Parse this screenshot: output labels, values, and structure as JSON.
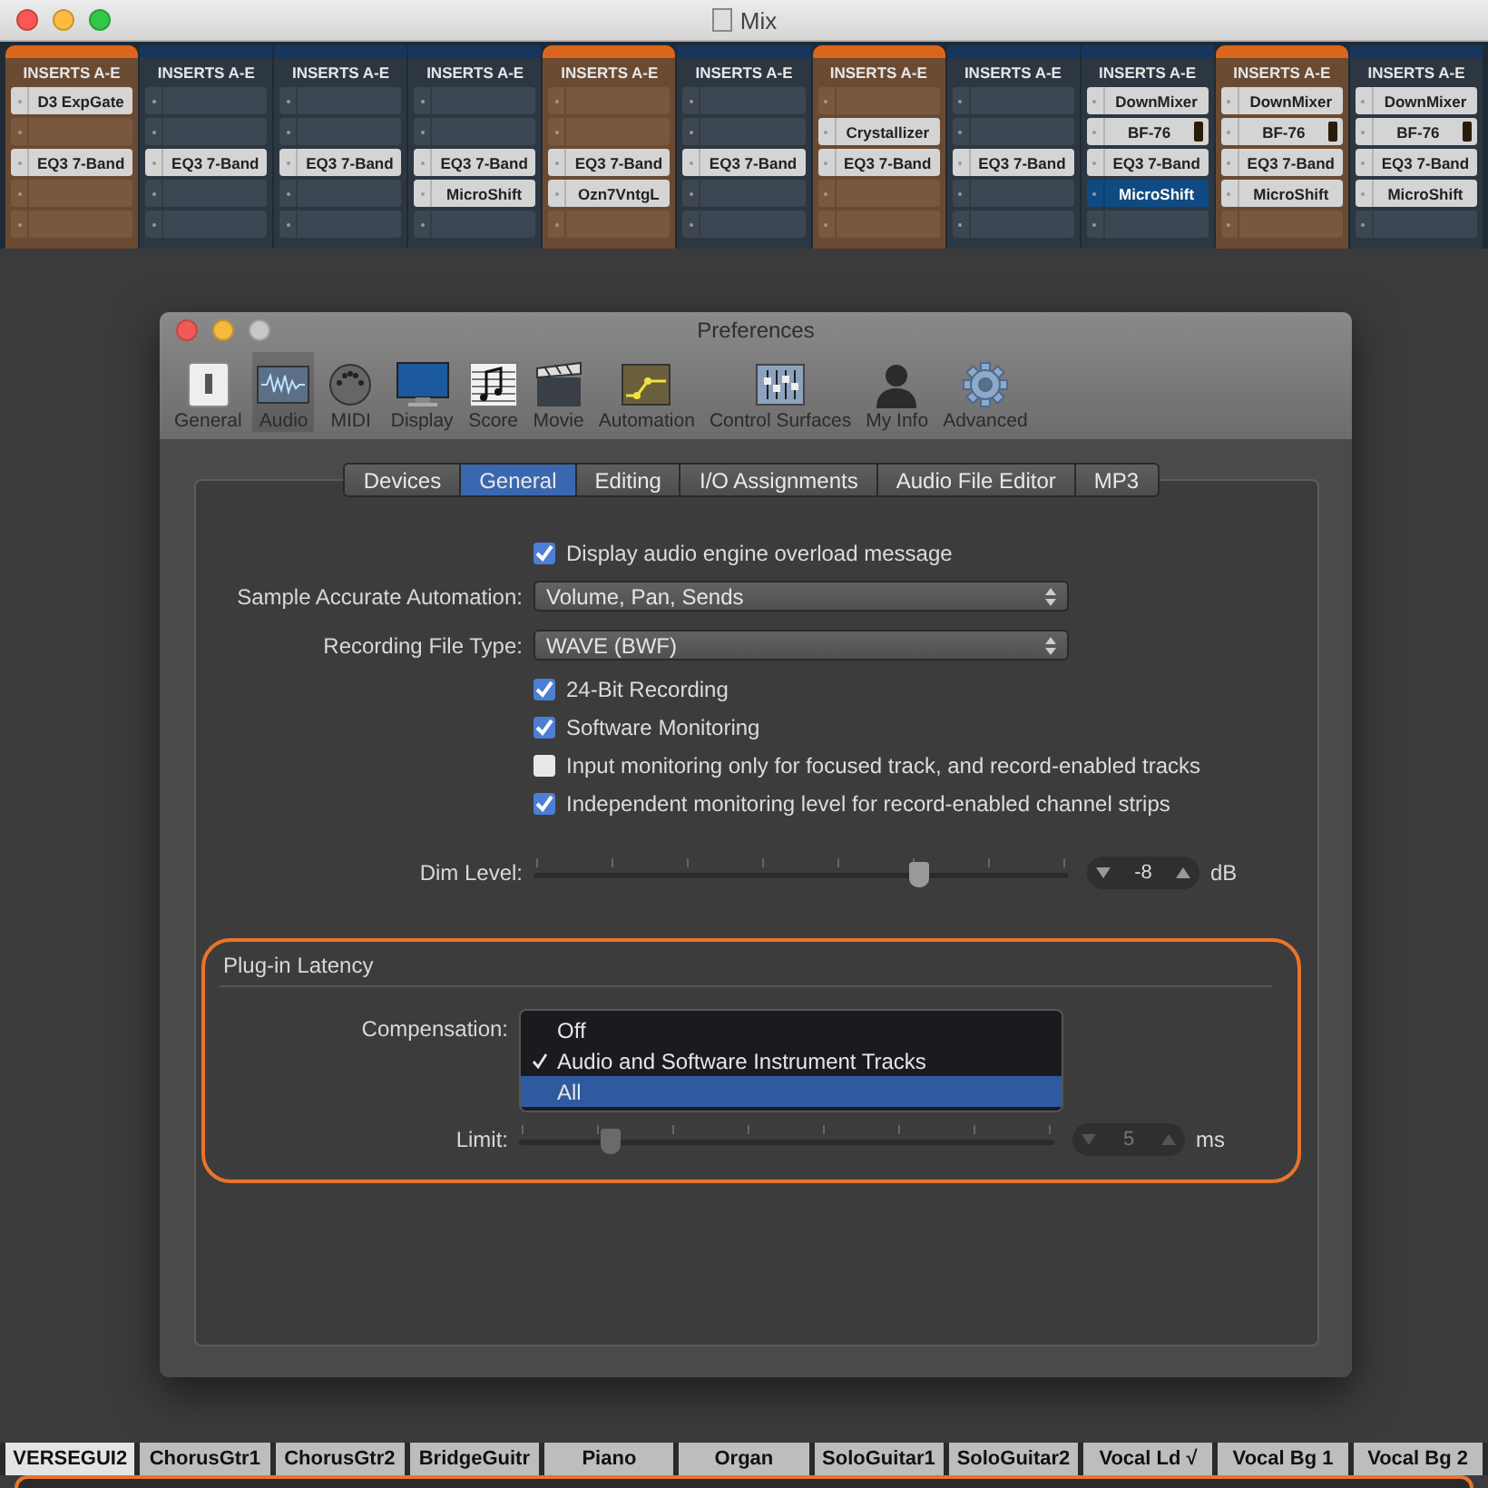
{
  "app_window": {
    "title": "Mix"
  },
  "strips": [
    {
      "header": "INSERTS A-E",
      "selected": true,
      "slots": [
        {
          "kind": "plugin",
          "name": "D3 ExpGate",
          "selected": false
        },
        {
          "kind": "empty",
          "selected": false
        },
        {
          "kind": "plugin",
          "name": "EQ3 7-Band",
          "selected": false
        },
        {
          "kind": "empty",
          "selected": false
        },
        {
          "kind": "empty",
          "selected": false
        }
      ]
    },
    {
      "header": "INSERTS A-E",
      "selected": false,
      "slots": [
        {
          "kind": "empty",
          "selected": false
        },
        {
          "kind": "empty",
          "selected": false
        },
        {
          "kind": "plugin",
          "name": "EQ3 7-Band",
          "selected": false
        },
        {
          "kind": "empty",
          "selected": false
        },
        {
          "kind": "empty",
          "selected": false
        }
      ]
    },
    {
      "header": "INSERTS A-E",
      "selected": false,
      "slots": [
        {
          "kind": "empty",
          "selected": false
        },
        {
          "kind": "empty",
          "selected": false
        },
        {
          "kind": "plugin",
          "name": "EQ3 7-Band",
          "selected": false
        },
        {
          "kind": "empty",
          "selected": false
        },
        {
          "kind": "empty",
          "selected": false
        }
      ]
    },
    {
      "header": "INSERTS A-E",
      "selected": false,
      "slots": [
        {
          "kind": "empty",
          "selected": false
        },
        {
          "kind": "empty",
          "selected": false
        },
        {
          "kind": "plugin",
          "name": "EQ3 7-Band",
          "selected": false
        },
        {
          "kind": "plugin",
          "name": "MicroShift",
          "selected": false
        },
        {
          "kind": "empty",
          "selected": false
        }
      ]
    },
    {
      "header": "INSERTS A-E",
      "selected": true,
      "slots": [
        {
          "kind": "empty",
          "selected": false
        },
        {
          "kind": "empty",
          "selected": false
        },
        {
          "kind": "plugin",
          "name": "EQ3 7-Band",
          "selected": false
        },
        {
          "kind": "plugin",
          "name": "Ozn7VntgL",
          "selected": false
        },
        {
          "kind": "empty",
          "selected": false
        }
      ]
    },
    {
      "header": "INSERTS A-E",
      "selected": false,
      "slots": [
        {
          "kind": "empty",
          "selected": false
        },
        {
          "kind": "empty",
          "selected": false
        },
        {
          "kind": "plugin",
          "name": "EQ3 7-Band",
          "selected": false
        },
        {
          "kind": "empty",
          "selected": false
        },
        {
          "kind": "empty",
          "selected": false
        }
      ]
    },
    {
      "header": "INSERTS A-E",
      "selected": true,
      "slots": [
        {
          "kind": "empty",
          "selected": false
        },
        {
          "kind": "plugin",
          "name": "Crystallizer",
          "selected": false
        },
        {
          "kind": "plugin",
          "name": "EQ3 7-Band",
          "selected": false
        },
        {
          "kind": "empty",
          "selected": false
        },
        {
          "kind": "empty",
          "selected": false
        }
      ]
    },
    {
      "header": "INSERTS A-E",
      "selected": false,
      "slots": [
        {
          "kind": "empty",
          "selected": false
        },
        {
          "kind": "empty",
          "selected": false
        },
        {
          "kind": "plugin",
          "name": "EQ3 7-Band",
          "selected": false
        },
        {
          "kind": "empty",
          "selected": false
        },
        {
          "kind": "empty",
          "selected": false
        }
      ]
    },
    {
      "header": "INSERTS A-E",
      "selected": false,
      "slots": [
        {
          "kind": "plugin",
          "name": "DownMixer",
          "selected": false
        },
        {
          "kind": "meter_plugin",
          "name": "BF-76",
          "selected": false
        },
        {
          "kind": "plugin",
          "name": "EQ3 7-Band",
          "selected": false
        },
        {
          "kind": "plugin",
          "name": "MicroShift",
          "selected": true
        },
        {
          "kind": "empty",
          "selected": false
        }
      ]
    },
    {
      "header": "INSERTS A-E",
      "selected": true,
      "slots": [
        {
          "kind": "plugin",
          "name": "DownMixer",
          "selected": false
        },
        {
          "kind": "meter_plugin",
          "name": "BF-76",
          "selected": false
        },
        {
          "kind": "plugin",
          "name": "EQ3 7-Band",
          "selected": false
        },
        {
          "kind": "plugin",
          "name": "MicroShift",
          "selected": false
        },
        {
          "kind": "empty",
          "selected": false
        }
      ]
    },
    {
      "header": "INSERTS A-E",
      "selected": false,
      "slots": [
        {
          "kind": "plugin",
          "name": "DownMixer",
          "selected": false
        },
        {
          "kind": "meter_plugin",
          "name": "BF-76",
          "selected": false
        },
        {
          "kind": "plugin",
          "name": "EQ3 7-Band",
          "selected": false
        },
        {
          "kind": "plugin",
          "name": "MicroShift",
          "selected": false
        },
        {
          "kind": "empty",
          "selected": false
        }
      ]
    }
  ],
  "preferences": {
    "title": "Preferences",
    "toolbar": [
      {
        "label": "General",
        "selected": false
      },
      {
        "label": "Audio",
        "selected": true
      },
      {
        "label": "MIDI",
        "selected": false
      },
      {
        "label": "Display",
        "selected": false
      },
      {
        "label": "Score",
        "selected": false
      },
      {
        "label": "Movie",
        "selected": false
      },
      {
        "label": "Automation",
        "selected": false
      },
      {
        "label": "Control Surfaces",
        "selected": false
      },
      {
        "label": "My Info",
        "selected": false
      },
      {
        "label": "Advanced",
        "selected": false
      }
    ],
    "tabs": [
      {
        "label": "Devices",
        "selected": false
      },
      {
        "label": "General",
        "selected": true
      },
      {
        "label": "Editing",
        "selected": false
      },
      {
        "label": "I/O Assignments",
        "selected": false
      },
      {
        "label": "Audio File Editor",
        "selected": false
      },
      {
        "label": "MP3",
        "selected": false
      }
    ],
    "rows": [
      {
        "kind": "checkbox",
        "label": "Display audio engine overload message",
        "checked": true
      },
      {
        "kind": "select",
        "label": "Sample Accurate Automation:",
        "value": "Volume, Pan, Sends"
      },
      {
        "kind": "select",
        "label": "Recording File Type:",
        "value": "WAVE (BWF)"
      },
      {
        "kind": "checkbox",
        "label": "24-Bit Recording",
        "checked": true
      },
      {
        "kind": "checkbox",
        "label": "Software Monitoring",
        "checked": true
      },
      {
        "kind": "checkbox",
        "label": "Input monitoring only for focused track, and record-enabled tracks",
        "checked": false
      },
      {
        "kind": "checkbox",
        "label": "Independent monitoring level for record-enabled channel strips",
        "checked": true
      },
      {
        "kind": "slider",
        "label": "Dim Level:",
        "level": 0.72,
        "value": "-8",
        "unit": "dB",
        "disabled": false
      }
    ],
    "latency": {
      "title": "Plug-in Latency",
      "compensation_label": "Compensation:",
      "options": [
        {
          "label": "Off",
          "checked": false,
          "selected": false
        },
        {
          "label": "Audio and Software Instrument Tracks",
          "checked": true,
          "selected": false
        },
        {
          "label": "All",
          "checked": false,
          "selected": true
        }
      ],
      "limit": {
        "label": "Limit:",
        "level": 0.17,
        "value": "5",
        "unit": "ms",
        "disabled": true
      }
    }
  },
  "tracks": [
    {
      "name": "VERSEGUI2",
      "selected": true
    },
    {
      "name": "ChorusGtr1",
      "selected": false
    },
    {
      "name": "ChorusGtr2",
      "selected": false
    },
    {
      "name": "BridgeGuitr",
      "selected": false
    },
    {
      "name": "Piano",
      "selected": false
    },
    {
      "name": "Organ",
      "selected": false
    },
    {
      "name": "SoloGuitar1",
      "selected": false
    },
    {
      "name": "SoloGuitar2",
      "selected": false
    },
    {
      "name": "Vocal Ld √",
      "selected": false
    },
    {
      "name": "Vocal Bg 1",
      "selected": false
    },
    {
      "name": "Vocal Bg 2",
      "selected": false
    }
  ]
}
